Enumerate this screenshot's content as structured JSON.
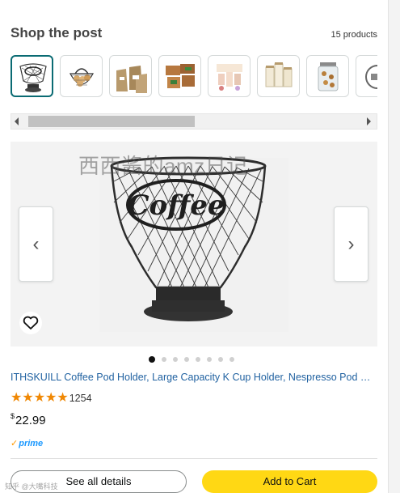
{
  "header": {
    "title": "Shop the post",
    "count": "15 products"
  },
  "thumbnails": [
    {
      "name": "coffee-basket",
      "active": true
    },
    {
      "name": "egg-basket"
    },
    {
      "name": "burlap-bags"
    },
    {
      "name": "wooden-crates"
    },
    {
      "name": "tea-boxes"
    },
    {
      "name": "canister-jars"
    },
    {
      "name": "cookie-jar"
    },
    {
      "name": "partial-item"
    }
  ],
  "hero": {
    "watermark": "西西酱的amz日记",
    "prev_icon": "‹",
    "next_icon": "›"
  },
  "carousel": {
    "dot_count": 8,
    "active_index": 0
  },
  "product": {
    "title": "ITHSKUILL Coffee Pod Holder, Large Capacity K Cup Holder, Nespresso Pod Holder",
    "rating": 5,
    "review_count": "1254",
    "price_symbol": "$",
    "price_value": "22.99",
    "prime_label": "prime",
    "prime_check": "✓"
  },
  "actions": {
    "details_label": "See all details",
    "cart_label": "Add to Cart"
  },
  "corner": "知乎 @大嘴科技",
  "colors": {
    "link": "#2162a1",
    "star": "#f08804",
    "cart_button": "#ffd814",
    "prime": "#1a98ff"
  }
}
